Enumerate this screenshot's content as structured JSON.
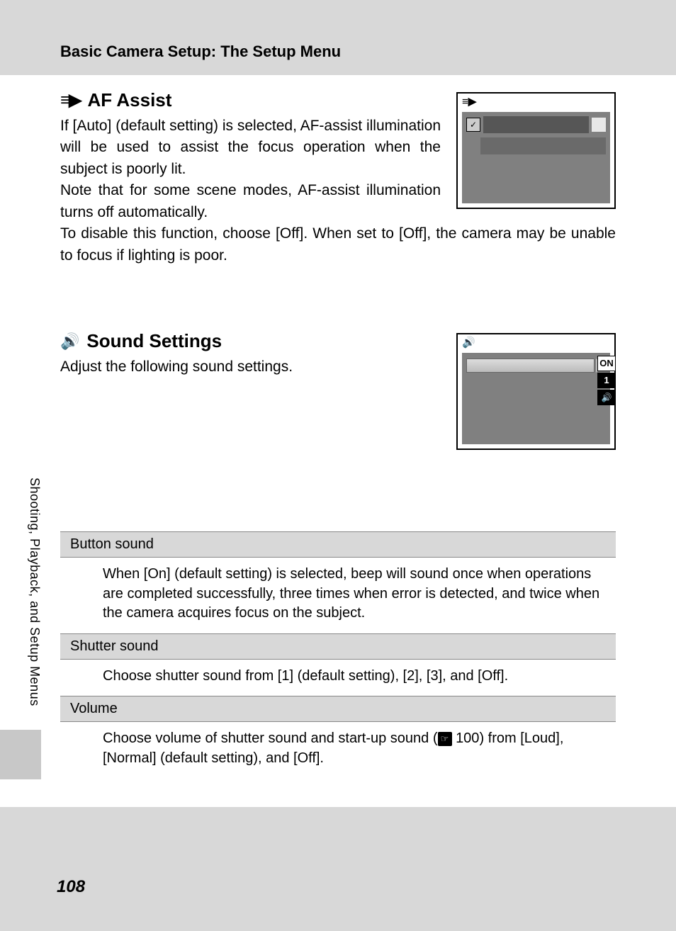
{
  "header": {
    "title": "Basic Camera Setup: The Setup Menu"
  },
  "section_af": {
    "heading": "AF Assist",
    "para1": "If [Auto] (default setting) is selected, AF-assist illumination will be used to assist the focus operation when the subject is poorly lit.",
    "para2": "Note that for some scene modes, AF-assist illumination turns off automatically.",
    "para3": "To disable this function, choose [Off]. When set to [Off], the camera may be unable to focus if lighting is poor.",
    "icon_label": "af-assist-icon"
  },
  "section_sound": {
    "heading": "Sound Settings",
    "intro": "Adjust the following sound settings.",
    "badges": {
      "b1": "ON",
      "b2": "1",
      "b3": "🔊"
    },
    "items": [
      {
        "title": "Button sound",
        "body": "When [On] (default setting) is selected, beep will sound once when operations are completed successfully, three times when error is detected, and twice when the camera acquires focus on the subject."
      },
      {
        "title": "Shutter sound",
        "body": "Choose shutter sound from [1] (default setting), [2], [3], and [Off]."
      },
      {
        "title": "Volume",
        "body_pre": "Choose volume of shutter sound and start-up sound (",
        "ref_page": "100",
        "body_post": ") from [Loud], [Normal] (default setting), and [Off]."
      }
    ]
  },
  "sidebar": "Shooting, Playback, and Setup Menus",
  "page_number": "108"
}
